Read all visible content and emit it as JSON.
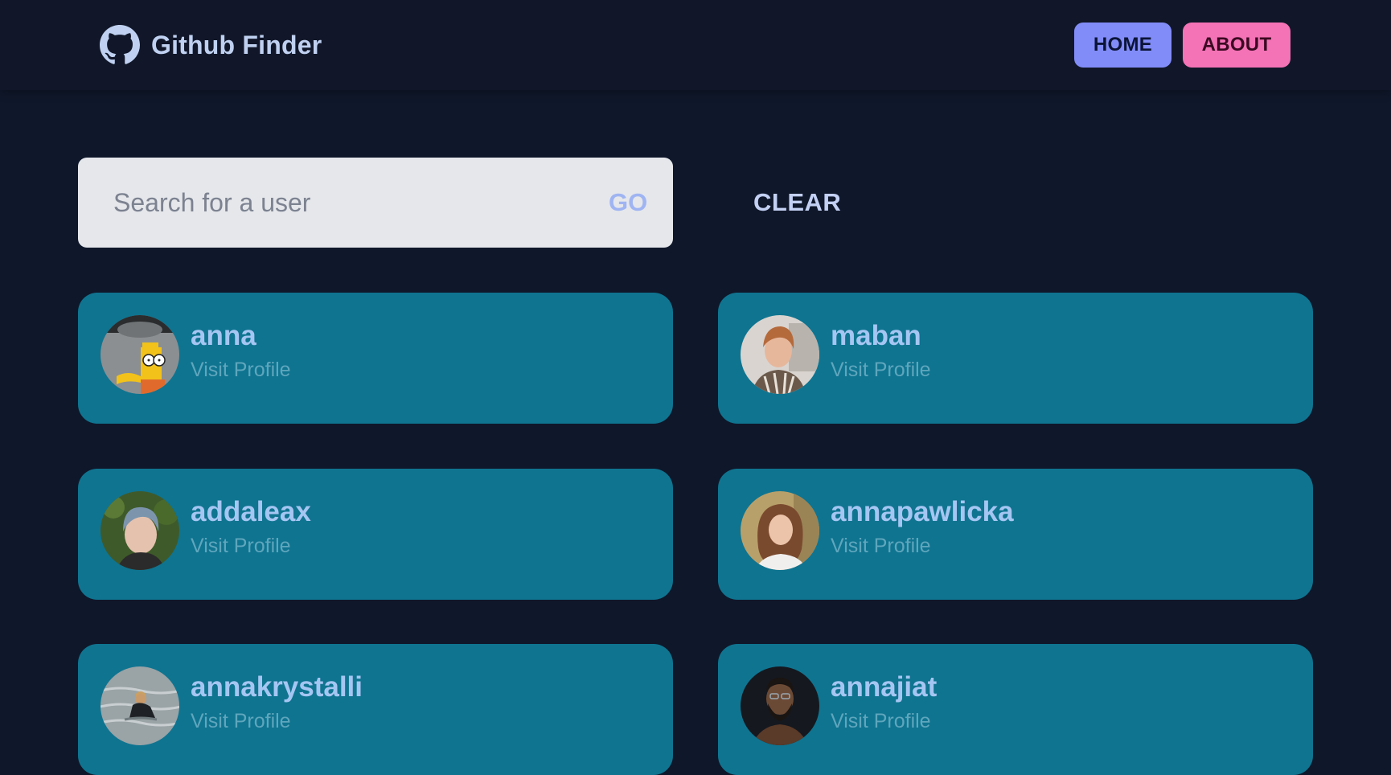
{
  "navbar": {
    "logo_icon": "github-icon",
    "title": "Github Finder",
    "home_label": "HOME",
    "about_label": "ABOUT"
  },
  "search": {
    "placeholder": "Search for a user",
    "value": "",
    "go_label": "GO",
    "clear_label": "CLEAR"
  },
  "users": [
    {
      "login": "anna",
      "link_label": "Visit Profile",
      "avatar_icon": "bart-simpson-avatar"
    },
    {
      "login": "maban",
      "link_label": "Visit Profile",
      "avatar_icon": "person-avatar"
    },
    {
      "login": "addaleax",
      "link_label": "Visit Profile",
      "avatar_icon": "person-avatar"
    },
    {
      "login": "annapawlicka",
      "link_label": "Visit Profile",
      "avatar_icon": "person-avatar"
    },
    {
      "login": "annakrystalli",
      "link_label": "Visit Profile",
      "avatar_icon": "person-in-water-avatar"
    },
    {
      "login": "annajiat",
      "link_label": "Visit Profile",
      "avatar_icon": "person-avatar"
    }
  ],
  "colors": {
    "background": "#0f172a",
    "card": "#0f7490",
    "home_button": "#818cf8",
    "about_button": "#f472b6"
  }
}
